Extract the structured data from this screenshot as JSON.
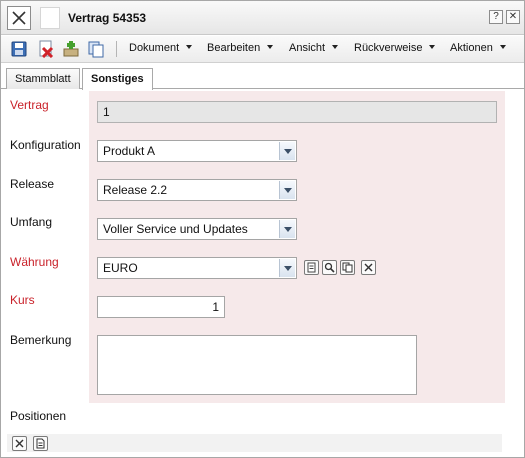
{
  "window": {
    "title": "Vertrag 54353",
    "help_label": "?",
    "close_label": "✕"
  },
  "toolbar": {
    "icons": [
      "save-icon",
      "delete-icon",
      "add-icon",
      "copy-icon"
    ],
    "menus": [
      "Dokument",
      "Bearbeiten",
      "Ansicht",
      "Rückverweise",
      "Aktionen"
    ]
  },
  "tabs": [
    {
      "label": "Stammblatt",
      "active": false
    },
    {
      "label": "Sonstiges",
      "active": true
    }
  ],
  "form": {
    "vertrag": {
      "label": "Vertrag",
      "value": "1"
    },
    "konfiguration": {
      "label": "Konfiguration",
      "value": "Produkt A"
    },
    "release": {
      "label": "Release",
      "value": "Release 2.2"
    },
    "umfang": {
      "label": "Umfang",
      "value": "Voller Service und Updates"
    },
    "waehrung": {
      "label": "Währung",
      "value": "EURO"
    },
    "kurs": {
      "label": "Kurs",
      "value": "1"
    },
    "bemerkung": {
      "label": "Bemerkung",
      "value": ""
    }
  },
  "positionen": {
    "label": "Positionen"
  },
  "colors": {
    "required_label": "#c9222a",
    "form_background": "#f6e9ea",
    "readonly_background": "#e6e6e6"
  }
}
